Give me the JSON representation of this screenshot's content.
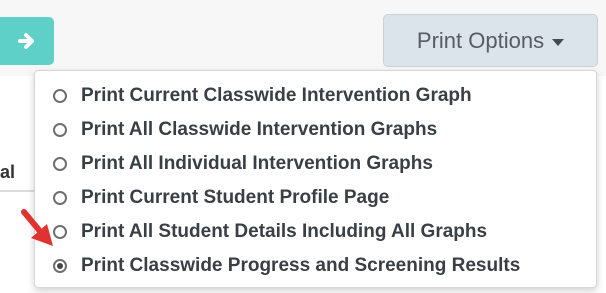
{
  "header": {
    "print_options_label": "Print Options",
    "left_fragment_text": "al"
  },
  "menu": {
    "items": [
      {
        "label": "Print Current Classwide Intervention Graph",
        "checked": false
      },
      {
        "label": "Print All Classwide Intervention Graphs",
        "checked": false
      },
      {
        "label": "Print All Individual Intervention Graphs",
        "checked": false
      },
      {
        "label": "Print Current Student Profile Page",
        "checked": false
      },
      {
        "label": "Print All Student Details Including All Graphs",
        "checked": false
      },
      {
        "label": "Print Classwide Progress and Screening Results",
        "checked": true
      }
    ]
  },
  "icons": {
    "left_button": "arrow-right-icon",
    "print_options_caret": "caret-down-icon",
    "annotation": "red-pointer-arrow-icon"
  },
  "colors": {
    "teal_button": "#5fd0c8",
    "print_button_bg": "#dbe4ea",
    "annotation_red": "#e0332f"
  }
}
